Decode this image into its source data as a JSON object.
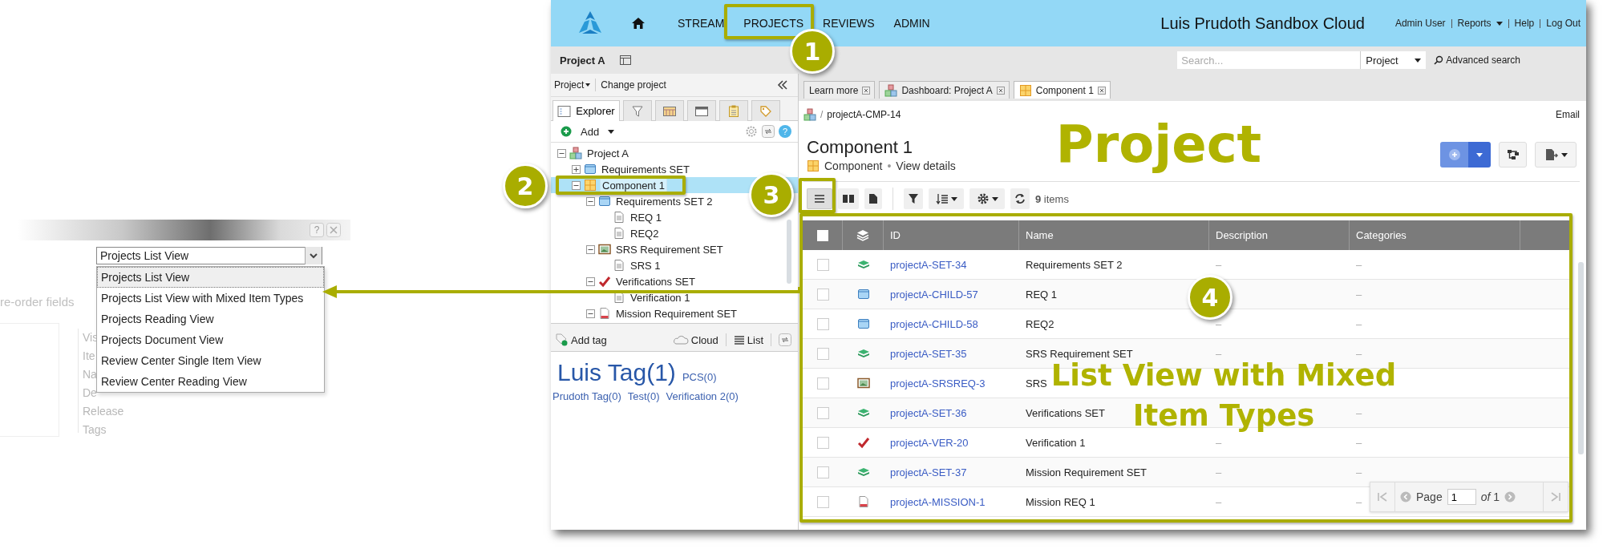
{
  "dialog": {
    "help": "?",
    "select": {
      "value": "Projects List View"
    },
    "options": [
      {
        "label": "Projects List View",
        "selected": true
      },
      {
        "label": "Projects List View with Mixed Item Types",
        "selected": false
      },
      {
        "label": "Projects Reading View",
        "selected": false
      },
      {
        "label": "Projects Document View",
        "selected": false
      },
      {
        "label": "Review Center Single Item View",
        "selected": false
      },
      {
        "label": "Review Center Reading View",
        "selected": false
      }
    ],
    "hint": "re-order fields",
    "legend": "Vis",
    "fields": [
      "Ite",
      "Na",
      "De",
      "Release",
      "Tags"
    ]
  },
  "header": {
    "nav": [
      "STREAM",
      "PROJECTS",
      "REVIEWS",
      "ADMIN"
    ],
    "site_title": "Luis Prudoth Sandbox Cloud",
    "links": [
      {
        "label": "Admin User",
        "dropdown": false
      },
      {
        "label": "Reports",
        "dropdown": true
      },
      {
        "label": "Help",
        "dropdown": false
      },
      {
        "label": "Log Out",
        "dropdown": false
      }
    ]
  },
  "subbar": {
    "project": "Project A",
    "search": {
      "placeholder": "Search..."
    },
    "scope": "Project",
    "advanced": "Advanced search"
  },
  "sidebar": {
    "project_menu": "Project",
    "change_project": "Change project",
    "tabs": [
      {
        "kind": "explorer",
        "label": "Explorer",
        "selected": true
      },
      {
        "kind": "filter",
        "selected": false
      },
      {
        "kind": "grid",
        "selected": false
      },
      {
        "kind": "window",
        "selected": false
      },
      {
        "kind": "clipboard",
        "selected": false
      },
      {
        "kind": "tag",
        "selected": false
      }
    ],
    "add": "Add",
    "help": "?",
    "tree": [
      {
        "label": "Project A",
        "kind": "project",
        "expanded": true,
        "selected": false,
        "children": [
          {
            "label": "Requirements SET",
            "kind": "window",
            "expanded": false,
            "selected": false
          },
          {
            "label": "Component 1",
            "kind": "component",
            "expanded": true,
            "selected": true,
            "children": [
              {
                "label": "Requirements SET 2",
                "kind": "window",
                "expanded": true,
                "selected": false,
                "children": [
                  {
                    "label": "REQ 1",
                    "kind": "document",
                    "selected": false
                  },
                  {
                    "label": "REQ2",
                    "kind": "document",
                    "selected": false
                  }
                ]
              },
              {
                "label": "SRS Requirement SET",
                "kind": "image",
                "expanded": true,
                "selected": false,
                "children": [
                  {
                    "label": "SRS 1",
                    "kind": "document",
                    "selected": false
                  }
                ]
              },
              {
                "label": "Verifications SET",
                "kind": "check",
                "expanded": true,
                "selected": false,
                "children": [
                  {
                    "label": "Verification 1",
                    "kind": "document",
                    "selected": false
                  }
                ]
              },
              {
                "label": "Mission Requirement SET",
                "kind": "mission",
                "expanded": true,
                "selected": false
              }
            ]
          }
        ]
      }
    ],
    "tag_bar": {
      "add_tag": "Add tag",
      "cloud": "Cloud",
      "list": "List"
    },
    "tags": [
      {
        "label": "Luis Tag(1)",
        "kind": "large"
      },
      {
        "label": "PCS(0)",
        "kind": "small"
      },
      {
        "label": "Prudoth Tag(0)",
        "kind": "small"
      },
      {
        "label": "Test(0)",
        "kind": "small"
      },
      {
        "label": "Verification 2(0)",
        "kind": "small"
      }
    ]
  },
  "tabs": [
    {
      "label": "Learn more",
      "kind": "plain",
      "selected": false
    },
    {
      "label": "Dashboard: Project A",
      "kind": "project",
      "selected": false
    },
    {
      "label": "Component 1",
      "kind": "component",
      "selected": true
    }
  ],
  "item": {
    "separator": "/",
    "id": "projectA-CMP-14",
    "email": "Email",
    "title": "Component 1",
    "type": "Component",
    "bullet": "•",
    "details": "View details"
  },
  "toolbar": {
    "views": [
      {
        "kind": "list",
        "selected": true
      },
      {
        "kind": "reading",
        "selected": false
      },
      {
        "kind": "document",
        "selected": false
      }
    ],
    "count": "**9** items"
  },
  "table": {
    "select_all": {
      "checked": false
    },
    "columns": [
      "ID",
      "Name",
      "Description",
      "Categories"
    ],
    "rows": [
      {
        "kind": "set",
        "checked": false,
        "id": "projectA-SET-34",
        "name": "Requirements SET 2",
        "description": "–",
        "categories": "–"
      },
      {
        "kind": "window",
        "checked": false,
        "id": "projectA-CHILD-57",
        "name": "REQ 1",
        "categories": "–"
      },
      {
        "kind": "window",
        "checked": false,
        "id": "projectA-CHILD-58",
        "name": "REQ2",
        "description": "–",
        "categories": "–"
      },
      {
        "kind": "set",
        "checked": false,
        "id": "projectA-SET-35",
        "name": "SRS Requirement SET",
        "description": "–",
        "categories": "–"
      },
      {
        "kind": "image",
        "checked": false,
        "id": "projectA-SRSREQ-3",
        "name": "SRS"
      },
      {
        "kind": "set",
        "checked": false,
        "id": "projectA-SET-36",
        "name": "Verifications SET",
        "categories": "–"
      },
      {
        "kind": "check",
        "checked": false,
        "id": "projectA-VER-20",
        "name": "Verification 1",
        "description": "–",
        "categories": "–"
      },
      {
        "kind": "set",
        "checked": false,
        "id": "projectA-SET-37",
        "name": "Mission Requirement SET",
        "description": "–",
        "categories": "–"
      },
      {
        "kind": "mission",
        "checked": false,
        "id": "projectA-MISSION-1",
        "name": "Mission REQ 1",
        "description": "–",
        "categories": "–"
      }
    ]
  },
  "pager": {
    "label": "Page",
    "page": "1",
    "of": "*of* 1"
  },
  "annotations": {
    "callouts": [
      "1",
      "2",
      "3",
      "4"
    ],
    "headings": [
      "Project",
      "List View with Mixed",
      "Item Types"
    ]
  }
}
